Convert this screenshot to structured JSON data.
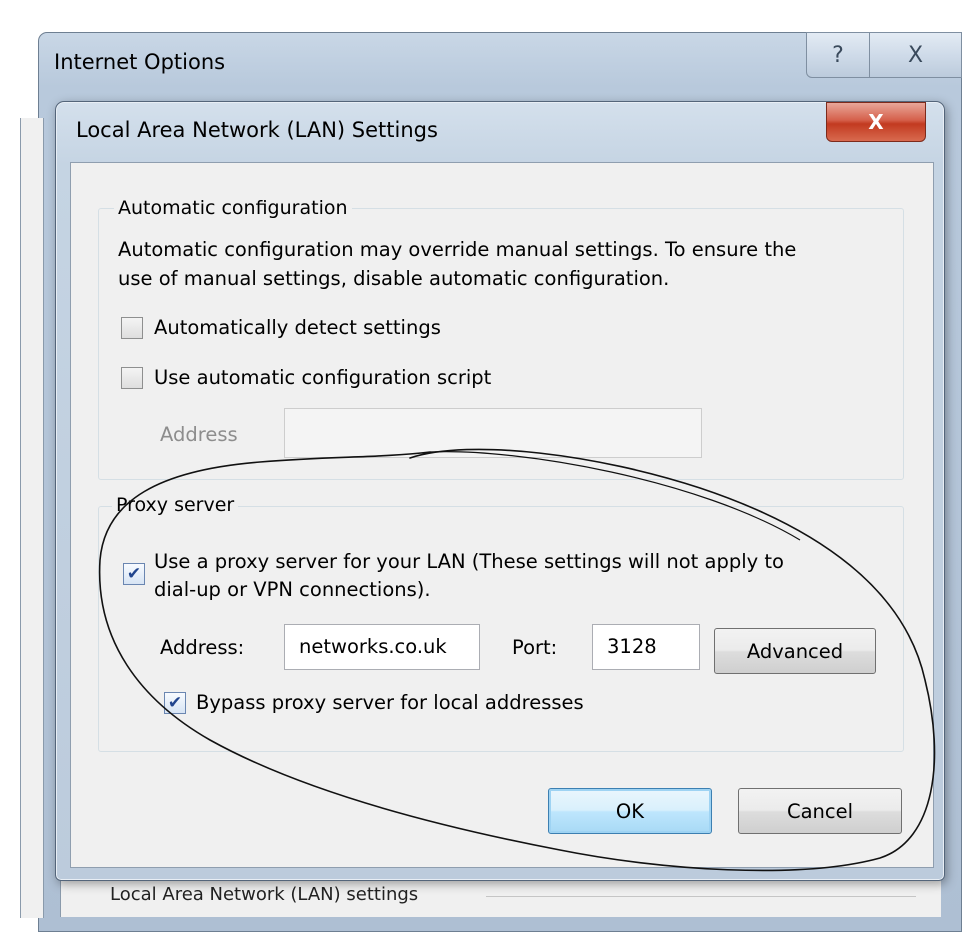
{
  "outer_window": {
    "title": "Internet Options",
    "help_label": "?",
    "close_label": "X",
    "bottom_section_label": "Local Area Network (LAN) settings"
  },
  "lan_dialog": {
    "title": "Local Area Network (LAN) Settings",
    "close_label": "X",
    "auto_config": {
      "group_label": "Automatic configuration",
      "description_line1": "Automatic configuration may override manual settings.  To ensure the",
      "description_line2": "use of manual settings, disable automatic configuration.",
      "detect_settings_label": "Automatically detect settings",
      "detect_settings_checked": false,
      "use_script_label": "Use automatic configuration script",
      "use_script_checked": false,
      "address_label": "Address",
      "address_value": ""
    },
    "proxy": {
      "group_label": "Proxy server",
      "use_proxy_label_line1": "Use a proxy server for your LAN (These settings will not apply to",
      "use_proxy_label_line2": "dial-up or VPN connections).",
      "use_proxy_checked": true,
      "address_label": "Address:",
      "address_value": "networks.co.uk",
      "port_label": "Port:",
      "port_value": "3128",
      "advanced_label": "Advanced",
      "bypass_label": "Bypass proxy server for local addresses",
      "bypass_checked": true
    },
    "buttons": {
      "ok_label": "OK",
      "cancel_label": "Cancel"
    }
  },
  "colors": {
    "title_bar": "#c5d4e3",
    "close_button": "#c23a20",
    "client_area": "#f0f0f0",
    "default_button_border": "#3c7fb1",
    "check_mark": "#21458e"
  },
  "icons": {
    "checkbox_check": "check-mark-icon",
    "help": "question-icon",
    "close": "close-icon"
  }
}
